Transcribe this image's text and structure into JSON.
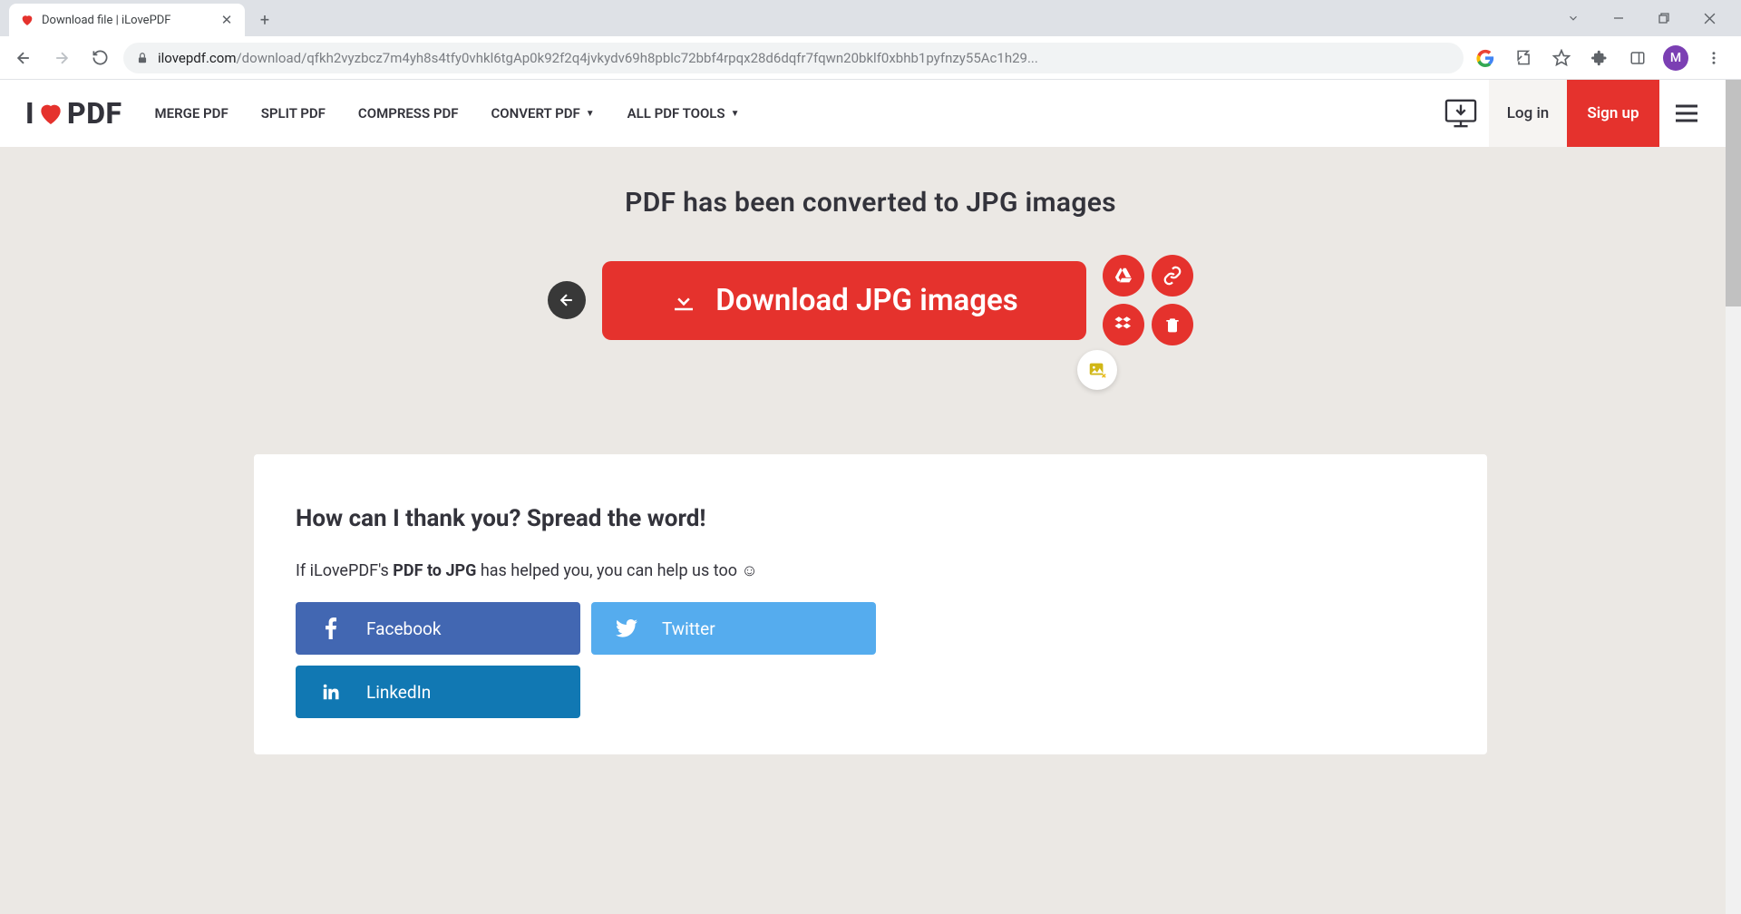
{
  "browser": {
    "tab_title": "Download file | iLovePDF",
    "url_host": "ilovepdf.com",
    "url_path": "/download/qfkh2vyzbcz7m4yh8s4tfy0vhkl6tgAp0k92f2q4jvkydv69h8pblc72bbf4rpqx28d6dqfr7fqwn20bklf0xbhb1pyfnzy55Ac1h29...",
    "avatar_letter": "M"
  },
  "header": {
    "logo_left": "I",
    "logo_right": "PDF",
    "nav": {
      "merge": "MERGE PDF",
      "split": "SPLIT PDF",
      "compress": "COMPRESS PDF",
      "convert": "CONVERT PDF",
      "all": "ALL PDF TOOLS"
    },
    "login": "Log in",
    "signup": "Sign up"
  },
  "main": {
    "headline": "PDF has been converted to JPG images",
    "download_label": "Download JPG images"
  },
  "spread": {
    "title": "How can I thank you? Spread the word!",
    "text_prefix": "If iLovePDF's ",
    "text_bold": "PDF to JPG",
    "text_suffix": " has helped you, you can help us too ☺",
    "facebook": "Facebook",
    "twitter": "Twitter",
    "linkedin": "LinkedIn"
  }
}
